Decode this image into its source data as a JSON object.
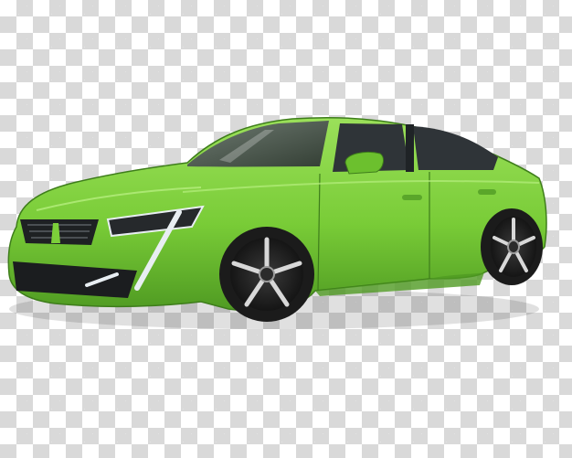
{
  "canvas": {
    "background": "transparency-checkerboard",
    "checker_light": "#ffffff",
    "checker_dark": "#d9d9d9"
  },
  "subject": {
    "icon": "car-icon",
    "body_color": "#7ccf3a",
    "body_shadow": "#5aa62a",
    "glass_color": "#3a3f44",
    "tire_color": "#1b1b1b",
    "rim_color": "#2b2b2b",
    "rim_accent": "#d8d8d8",
    "light_color": "#e8eef2"
  }
}
